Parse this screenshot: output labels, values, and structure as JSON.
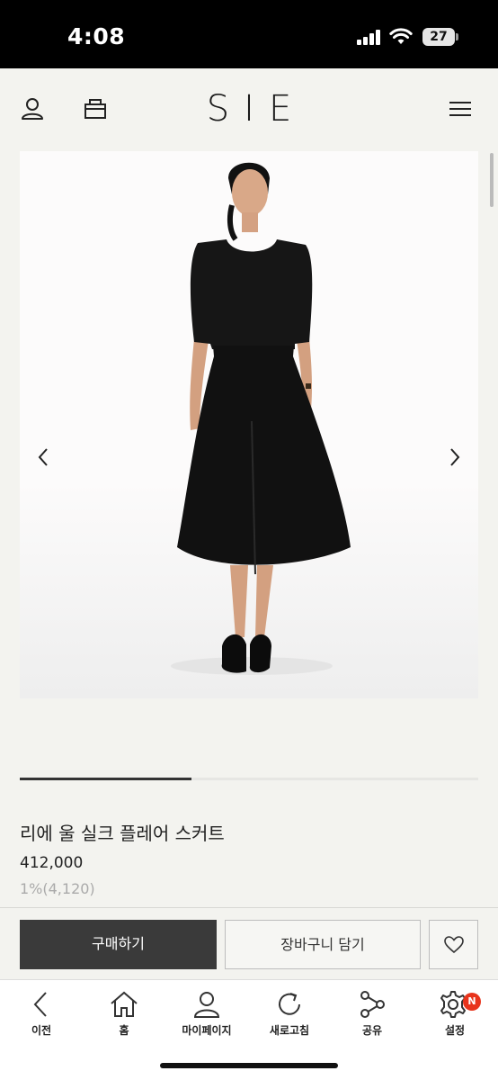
{
  "status_bar": {
    "time": "4:08",
    "battery": "27"
  },
  "header": {
    "logo": "SIE",
    "icons": [
      "user-icon",
      "bag-icon",
      "hamburger-menu-icon"
    ]
  },
  "gallery": {
    "image": "product-photo-black-silk-flare-dress",
    "prev_icon": "chevron-left-icon",
    "next_icon": "chevron-right-icon",
    "progress": 0.375
  },
  "product": {
    "name": "리에 울 실크 플레어 스커트",
    "price": "412,000",
    "point": "1%(4,120)"
  },
  "actions": {
    "buy_label": "구매하기",
    "cart_label": "장바구니 담기",
    "wish_icon": "heart-icon"
  },
  "bottom_nav": [
    {
      "label": "이전",
      "icon": "back-icon"
    },
    {
      "label": "홈",
      "icon": "home-icon"
    },
    {
      "label": "마이페이지",
      "icon": "user-icon"
    },
    {
      "label": "새로고침",
      "icon": "refresh-icon"
    },
    {
      "label": "공유",
      "icon": "share-icon"
    },
    {
      "label": "설정",
      "icon": "settings-icon",
      "badge": "N"
    }
  ],
  "colors": {
    "primary_button": "#3a3a3a",
    "badge": "#e8341c",
    "background": "#f3f3ef"
  }
}
